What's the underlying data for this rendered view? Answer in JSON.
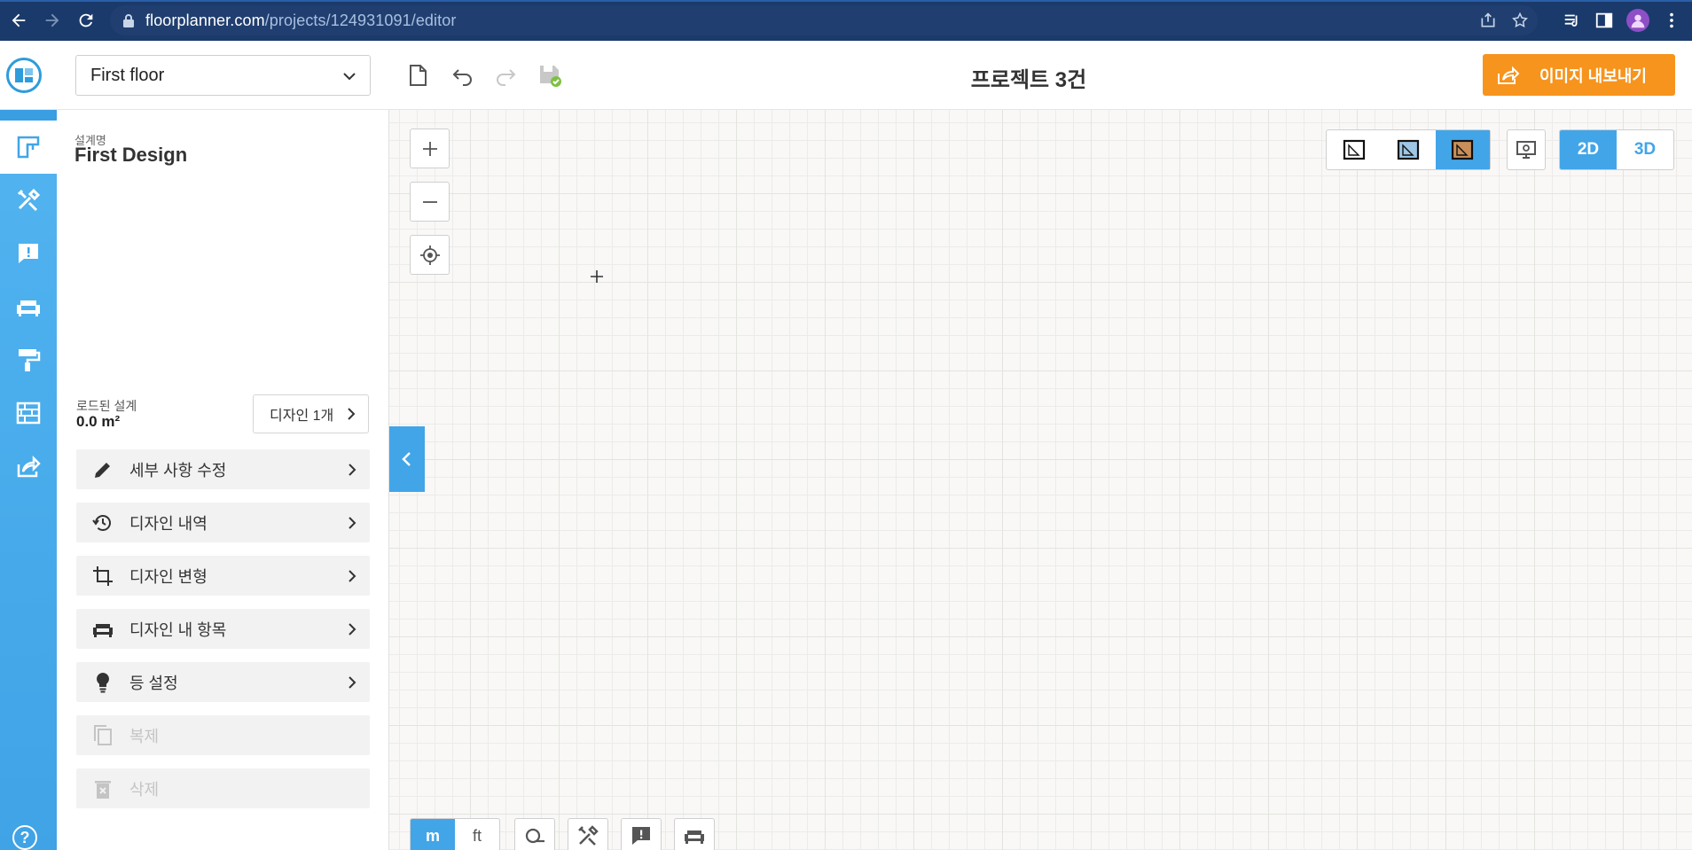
{
  "browser": {
    "url_host": "floorplanner.com",
    "url_path": "/projects/124931091/editor"
  },
  "header": {
    "floor_selected": "First floor",
    "project_title": "프로젝트 3건",
    "export_label": "이미지 내보내기",
    "export_color": "#f7941d"
  },
  "sidebar": {
    "design_caption": "설계명",
    "design_name": "First Design",
    "loaded_caption": "로드된 설계",
    "loaded_area": "0.0 m²",
    "design_count_label": "디자인 1개",
    "menu": [
      {
        "label": "세부 사항 수정",
        "icon": "pencil-icon",
        "disabled": false
      },
      {
        "label": "디자인 내역",
        "icon": "history-icon",
        "disabled": false
      },
      {
        "label": "디자인 변형",
        "icon": "crop-icon",
        "disabled": false
      },
      {
        "label": "디자인 내 항목",
        "icon": "sofa-icon",
        "disabled": false
      },
      {
        "label": "등 설정",
        "icon": "bulb-icon",
        "disabled": false
      },
      {
        "label": "복제",
        "icon": "copy-icon",
        "disabled": true
      },
      {
        "label": "삭제",
        "icon": "trash-icon",
        "disabled": true
      }
    ],
    "accent_color": "#42a5e8"
  },
  "canvas": {
    "dim_2d": "2D",
    "dim_3d": "3D",
    "active_dim": "2D",
    "unit_m": "m",
    "unit_ft": "ft",
    "active_unit": "m",
    "active_view_mode": "textured-view"
  }
}
